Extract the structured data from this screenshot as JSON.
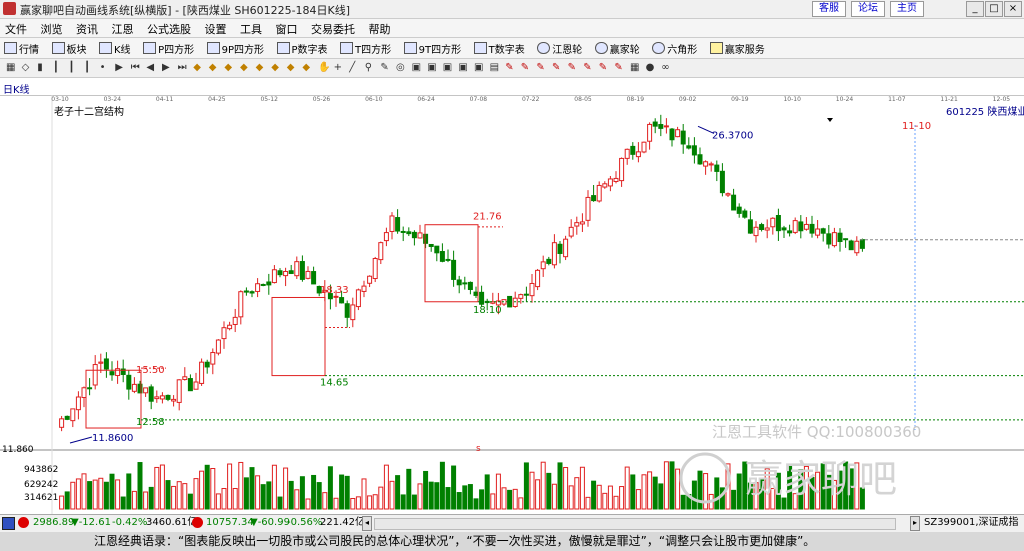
{
  "window": {
    "title": "赢家聊吧自动画线系统[纵横版] - [陕西煤业  SH601225-184日K线]",
    "links": [
      "客服",
      "论坛",
      "主页"
    ]
  },
  "menu": [
    "文件",
    "浏览",
    "资讯",
    "江恩",
    "公式选股",
    "设置",
    "工具",
    "窗口",
    "交易委托",
    "帮助"
  ],
  "toolbar": [
    "行情",
    "板块",
    "K线",
    "P四方形",
    "9P四方形",
    "P数字表",
    "T四方形",
    "9T四方形",
    "T数字表",
    "江恩轮",
    "赢家轮",
    "六角形",
    "赢家服务"
  ],
  "period_label": "日K线",
  "time_axis": [
    "03-10",
    "03-24",
    "04-11",
    "04-25",
    "05-12",
    "05-26",
    "06-10",
    "06-24",
    "07-08",
    "07-22",
    "08-05",
    "08-19",
    "09-02",
    "09-19",
    "10-10",
    "10-24",
    "11-07",
    "11-21",
    "12-05"
  ],
  "chart_data": {
    "type": "candlestick",
    "title": "老子十二宫结构",
    "symbol_label": "601225 陕西煤业",
    "date_marker": "11-10",
    "price_labels": [
      "11.8600",
      "12.58",
      "15.50",
      "14.65",
      "18.33",
      "21.76",
      "18.10",
      "26.3700"
    ],
    "left_price": "11.860",
    "volume_axis": [
      "943862",
      "629242",
      "314621"
    ],
    "marker_char": "s",
    "watermark": [
      "江恩工具软件 QQ:100800360",
      "赢家聊吧"
    ],
    "colors": {
      "up": "#e02020",
      "down": "#008000",
      "box": "#e02020",
      "dashed": "#008000"
    }
  },
  "status": {
    "sh_index": "2986.89",
    "sh_change": "▼-12.61",
    "sh_pct": "-0.42%",
    "sh_amount": "3460.61亿",
    "sz_index": "10757.34",
    "sz_change": "▼-60.99",
    "sz_pct": "-0.56%",
    "sz_amount": "221.42亿",
    "right_code": "SZ399001,深证成指"
  },
  "quote": "江恩经典语录：“图表能反映出一切股市或公司股民的总体心理状况”，“不要一次性买进，傲慢就是罪过”，“调整只会让股市更加健康”。"
}
